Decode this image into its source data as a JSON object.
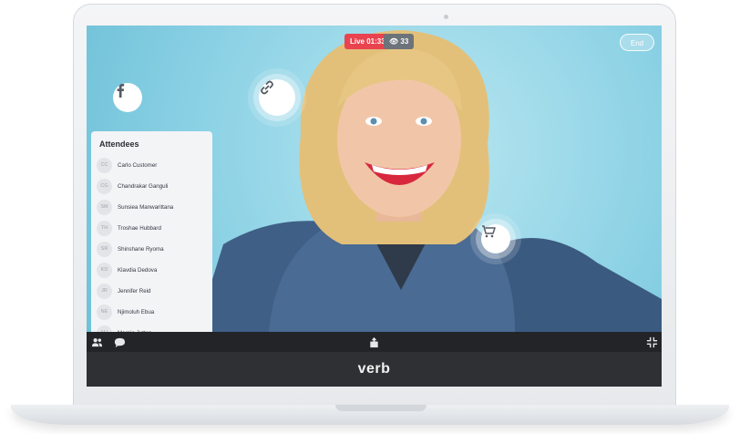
{
  "stream": {
    "live_label": "Live 01:33",
    "viewer_count": "33",
    "end_label": "End"
  },
  "attendees": {
    "title": "Attendees",
    "items": [
      {
        "initials": "CC",
        "name": "Carlo Customer"
      },
      {
        "initials": "CG",
        "name": "Chandrakar Ganguli"
      },
      {
        "initials": "SM",
        "name": "Sunsiea Manwarittana"
      },
      {
        "initials": "TH",
        "name": "Troshae Hubbard"
      },
      {
        "initials": "SR",
        "name": "Shinshane Ryoma"
      },
      {
        "initials": "KD",
        "name": "Klavdia Dedova"
      },
      {
        "initials": "JR",
        "name": "Jennifer Reid"
      },
      {
        "initials": "NE",
        "name": "Njimoluh Ebua"
      },
      {
        "initials": "MJ",
        "name": "Margie Jutten"
      }
    ]
  },
  "brand": {
    "name": "verb"
  },
  "icons": {
    "facebook": "facebook-icon",
    "link": "link-icon",
    "cart": "cart-icon",
    "people": "people-icon",
    "chat": "chat-icon",
    "share": "share-icon",
    "minimize": "minimize-icon",
    "eye": "eye-icon"
  },
  "colors": {
    "live": "#e8434f",
    "viewers": "#6d737a",
    "video_bg": "#8fd3e6",
    "panel": "#f3f4f6",
    "controls": "#222428",
    "brandbar": "#2e3034"
  }
}
